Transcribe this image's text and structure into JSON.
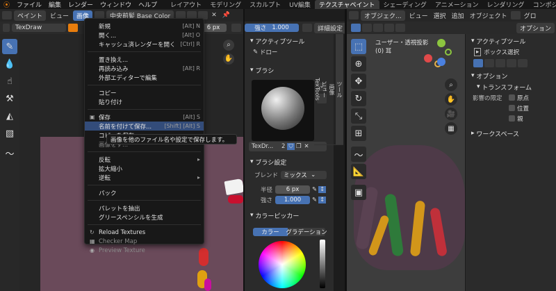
{
  "topbar": {
    "menus": [
      "ファイル",
      "編集",
      "レンダー",
      "ウィンドウ",
      "ヘルプ"
    ],
    "tabs": [
      "レイアウト",
      "モデリング",
      "スカルプト",
      "UV編集",
      "テクスチャペイント",
      "シェーディング",
      "アニメーション",
      "レンダリング",
      "コンポジティング"
    ],
    "active_tab": "テクスチャペイント"
  },
  "image_editor": {
    "mode": "ペイント",
    "menus": [
      "ビュー",
      "画像"
    ],
    "image_name": "中央前髪 Base Color",
    "brush_name": "TexDraw",
    "radius": "6 px",
    "strength_label": "強さ",
    "strength": "1.000",
    "details": "詳細設定"
  },
  "image_menu": {
    "items": [
      {
        "label": "新規",
        "shortcut": "[Alt] N",
        "icon": ""
      },
      {
        "label": "開く...",
        "shortcut": "[Alt] O",
        "icon": ""
      },
      {
        "label": "キャッシュ済レンダーを開く",
        "shortcut": "[Ctrl] R",
        "icon": ""
      },
      {
        "sep": true
      },
      {
        "label": "置き換え...",
        "shortcut": "",
        "icon": ""
      },
      {
        "label": "再読み込み",
        "shortcut": "[Alt] R",
        "icon": ""
      },
      {
        "label": "外部エディターで編集",
        "shortcut": "",
        "icon": ""
      },
      {
        "sep": true
      },
      {
        "label": "コピー",
        "shortcut": "",
        "icon": ""
      },
      {
        "label": "貼り付け",
        "shortcut": "",
        "icon": ""
      },
      {
        "sep": true
      },
      {
        "label": "保存",
        "shortcut": "[Alt] S",
        "icon": "▣"
      },
      {
        "label": "名前を付けて保存...",
        "shortcut": "[Shift] [Alt] S",
        "icon": "",
        "highlight": true
      },
      {
        "label": "コピーを保存...",
        "shortcut": "",
        "icon": ""
      },
      {
        "label": "画像をす...",
        "shortcut": "",
        "icon": "",
        "dim": true
      },
      {
        "sep": true
      },
      {
        "label": "反転",
        "shortcut": "▸",
        "icon": ""
      },
      {
        "label": "拡大縮小",
        "shortcut": "",
        "icon": ""
      },
      {
        "label": "逆転",
        "shortcut": "▸",
        "icon": ""
      },
      {
        "sep": true
      },
      {
        "label": "パック",
        "shortcut": "",
        "icon": ""
      },
      {
        "sep": true
      },
      {
        "label": "パレットを抽出",
        "shortcut": "",
        "icon": ""
      },
      {
        "label": "グリースペンシルを生成",
        "shortcut": "",
        "icon": ""
      },
      {
        "sep": true
      },
      {
        "label": "Reload Textures",
        "shortcut": "",
        "icon": "↻"
      },
      {
        "label": "Checker Map",
        "shortcut": "",
        "icon": "▦",
        "dim": true
      },
      {
        "label": "Preview Texture",
        "shortcut": "",
        "icon": "◉",
        "dim": true
      }
    ]
  },
  "tooltip": "画像を他のファイル名や設定で保存します。",
  "properties": {
    "active_tool_header": "アクティブツール",
    "tool_name": "ドロー",
    "brush_header": "ブラシ",
    "brush_name": "TexDr...",
    "brush_users": "2",
    "brush_settings_header": "ブラシ設定",
    "blend_label": "ブレンド",
    "blend_value": "ミックス",
    "radius_label": "半径",
    "radius_value": "6 px",
    "strength_label": "強さ",
    "strength_value": "1.000",
    "color_picker_header": "カラーピッカー",
    "tab_color": "カラー",
    "tab_gradient": "グラデーション"
  },
  "side_tabs": [
    "ツール",
    "画像",
    "ビュー",
    "TexTools"
  ],
  "viewport": {
    "mode": "オブジェク...",
    "menus": [
      "ビュー",
      "選択",
      "追加",
      "オブジェクト"
    ],
    "global": "グロ",
    "options": "オプション",
    "view_name": "ユーザー・透視投影",
    "object_name": "(0) 耳"
  },
  "n_panel": {
    "active_tool_header": "アクティブツール",
    "tool_name": "ボックス選択",
    "options_header": "オプション",
    "transform_header": "トランスフォーム",
    "affect_label": "影響の限定",
    "affect_items": [
      "原点",
      "位置",
      "親"
    ],
    "workspace_header": "ワークスペース"
  },
  "colors": {
    "accent": "#4772b3",
    "canvas": "#6a4a5a",
    "menu_bg": "#181818",
    "highlight": "#334c7a"
  }
}
